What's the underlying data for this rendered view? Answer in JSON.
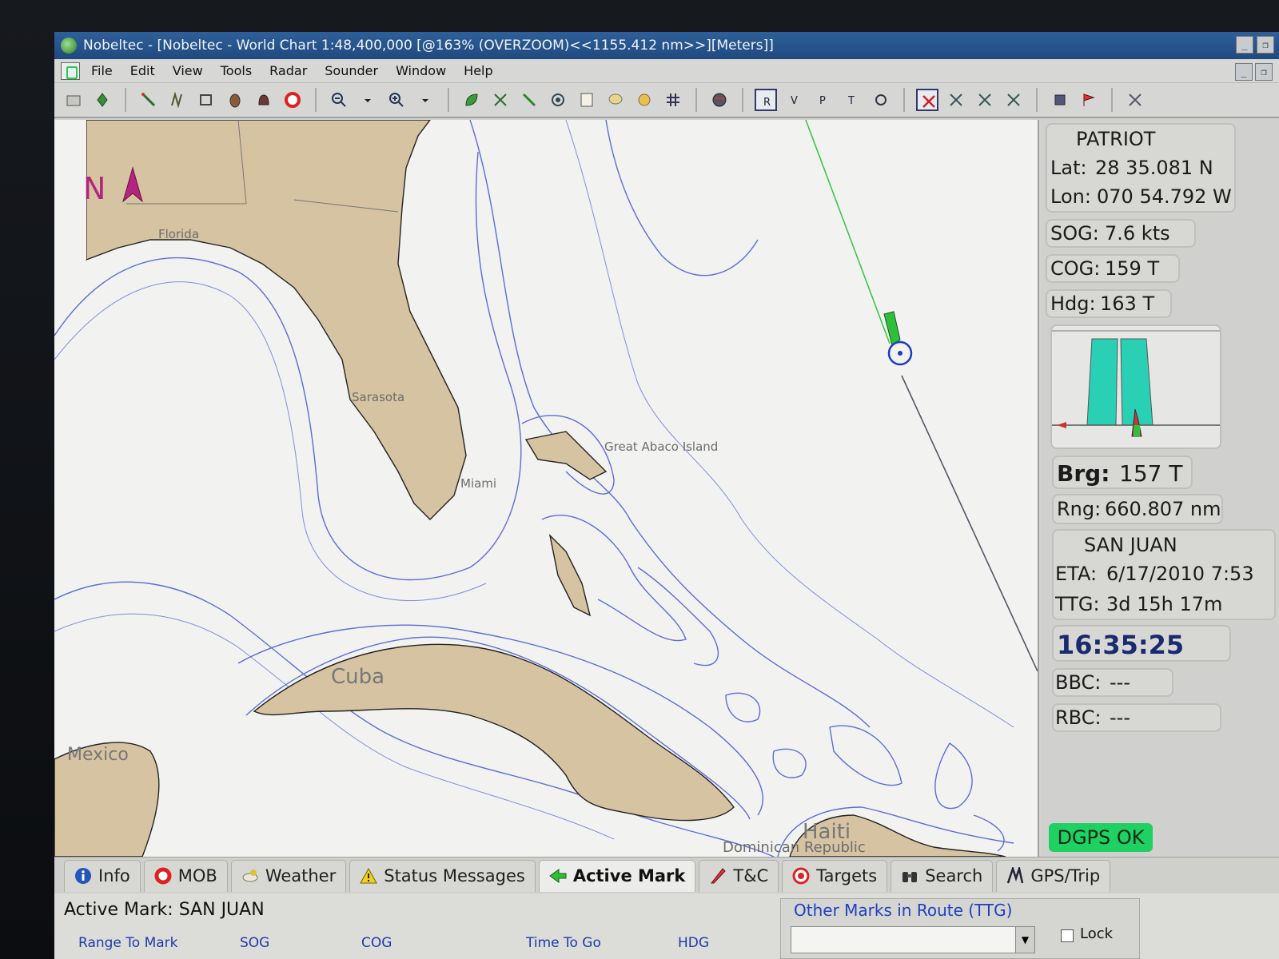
{
  "window": {
    "title": "Nobeltec - [Nobeltec - World Chart 1:48,400,000 [@163% (OVERZOOM)<<1155.412 nm>>][Meters]]",
    "controls": [
      "_",
      "❐"
    ]
  },
  "menu": [
    "File",
    "Edit",
    "View",
    "Tools",
    "Radar",
    "Sounder",
    "Window",
    "Help"
  ],
  "chart": {
    "labels": {
      "florida": "Florida",
      "sarasota": "Sarasota",
      "miami": "Miami",
      "abaco": "Great Abaco Island",
      "cuba": "Cuba",
      "mexico": "Mexico",
      "haiti": "Haiti",
      "dominican": "Dominican Republic"
    },
    "north_arrow": "N"
  },
  "vessel": {
    "name": "PATRIOT",
    "lat_label": "Lat:",
    "lat": "28 35.081 N",
    "lon_label": "Lon:",
    "lon": "070 54.792 W",
    "sog_label": "SOG:",
    "sog": "7.6 kts",
    "cog_label": "COG:",
    "cog": "159 T",
    "hdg_label": "Hdg:",
    "hdg": "163 T"
  },
  "nav": {
    "brg_label": "Brg:",
    "brg": "157 T",
    "rng_label": "Rng:",
    "rng": "660.807 nm",
    "dest": "SAN JUAN",
    "eta_label": "ETA:",
    "eta": "6/17/2010 7:53",
    "ttg_label": "TTG:",
    "ttg": "3d 15h 17m",
    "clock": "16:35:25",
    "bbc_label": "BBC:",
    "bbc": "---",
    "rbc_label": "RBC:",
    "rbc": "---",
    "gps_status": "DGPS OK"
  },
  "colors": {
    "accent": "#1fd162",
    "steer_bars": "#2ad0b4",
    "track": "#3bc64a",
    "ship": "#2fbf3a",
    "depth": "#5a6ed6"
  },
  "tabs": [
    {
      "label": "Info",
      "icon": "info-icon"
    },
    {
      "label": "MOB",
      "icon": "lifebuoy-icon"
    },
    {
      "label": "Weather",
      "icon": "weather-icon"
    },
    {
      "label": "Status Messages",
      "icon": "warning-icon"
    },
    {
      "label": "Active Mark",
      "icon": "active-mark-icon",
      "active": true
    },
    {
      "label": "T&C",
      "icon": "tide-current-icon"
    },
    {
      "label": "Targets",
      "icon": "target-icon"
    },
    {
      "label": "Search",
      "icon": "binoculars-icon"
    },
    {
      "label": "GPS/Trip",
      "icon": "gps-icon"
    }
  ],
  "info": {
    "active_mark": "Active Mark: SAN JUAN",
    "columns": [
      "Range To Mark",
      "SOG",
      "COG",
      "Time To Go",
      "HDG"
    ],
    "other_marks_title": "Other Marks in Route (TTG)",
    "lock_label": "Lock"
  }
}
